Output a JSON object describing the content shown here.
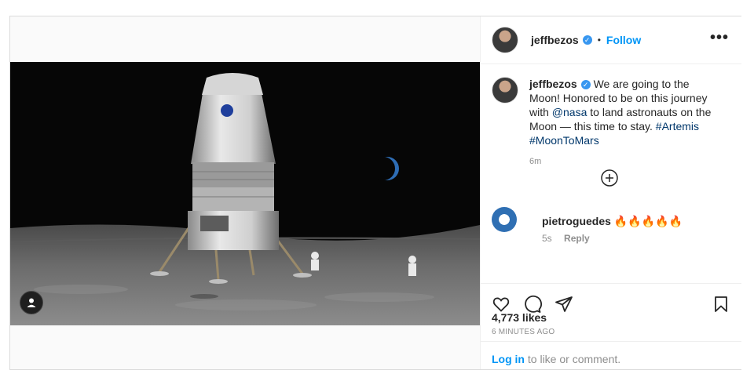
{
  "header": {
    "username": "jeffbezos",
    "separator": "•",
    "follow_label": "Follow",
    "more_label": "•••"
  },
  "caption": {
    "username": "jeffbezos",
    "text_1": "We are going to the Moon! Honored to be on this journey with ",
    "mention": "@nasa",
    "text_2": " to land astronauts on the Moon — this time to stay. ",
    "hashtag_1": "#Artemis",
    "hashtag_2": "#MoonToMars",
    "time": "6m"
  },
  "comments": [
    {
      "username": "pietroguedes",
      "text": "🔥🔥🔥🔥🔥",
      "time": "5s",
      "reply_label": "Reply"
    }
  ],
  "stats": {
    "likes": "4,773 likes",
    "time_ago": "6 MINUTES AGO"
  },
  "login": {
    "link": "Log in",
    "rest": " to like or comment."
  },
  "icons": {
    "verified": "verified-badge-icon",
    "like": "heart-icon",
    "comment": "comment-icon",
    "share": "paper-plane-icon",
    "save": "bookmark-icon",
    "load_more": "plus-circle-icon",
    "tag": "user-tag-icon"
  },
  "colors": {
    "accent": "#0095f6",
    "verified": "#3897f0",
    "hashtag": "#00376b",
    "muted": "#8e8e8e"
  }
}
